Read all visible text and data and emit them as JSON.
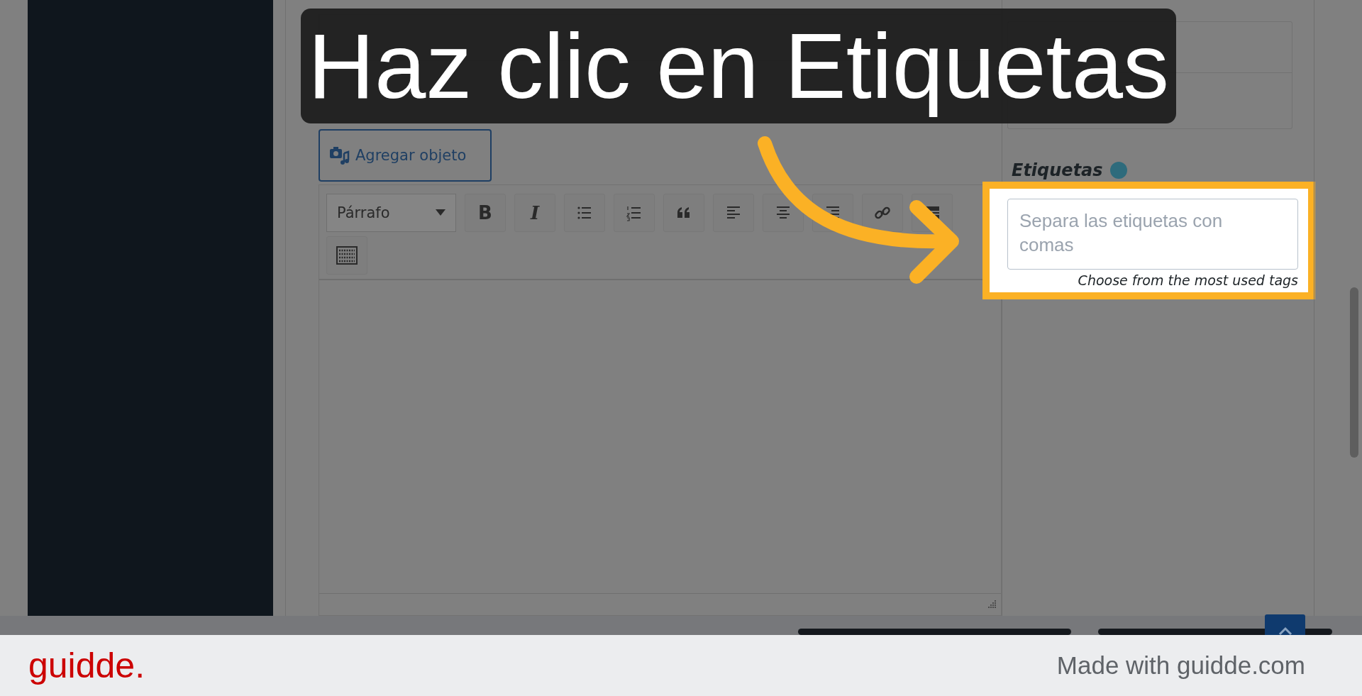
{
  "callout": {
    "text": "Haz clic en Etiquetas"
  },
  "editor": {
    "add_media_button": "Agregar objeto",
    "format_select": "Párrafo",
    "toolbar_buttons": [
      {
        "kind": "bold",
        "label": "B"
      },
      {
        "kind": "italic",
        "label": "I"
      },
      {
        "kind": "bullet-list"
      },
      {
        "kind": "numbered-list"
      },
      {
        "kind": "quote"
      },
      {
        "kind": "align-left"
      },
      {
        "kind": "align-center"
      },
      {
        "kind": "align-right"
      },
      {
        "kind": "link"
      },
      {
        "kind": "more"
      },
      {
        "kind": "toolbar-toggle"
      }
    ]
  },
  "sidebar": {
    "tags": {
      "label": "Etiquetas",
      "placeholder": "Separa las etiquetas con comas",
      "most_used_link": "Choose from the most used tags"
    }
  },
  "footer": {
    "logo": "guidde.",
    "credit": "Made with guidde.com"
  }
}
